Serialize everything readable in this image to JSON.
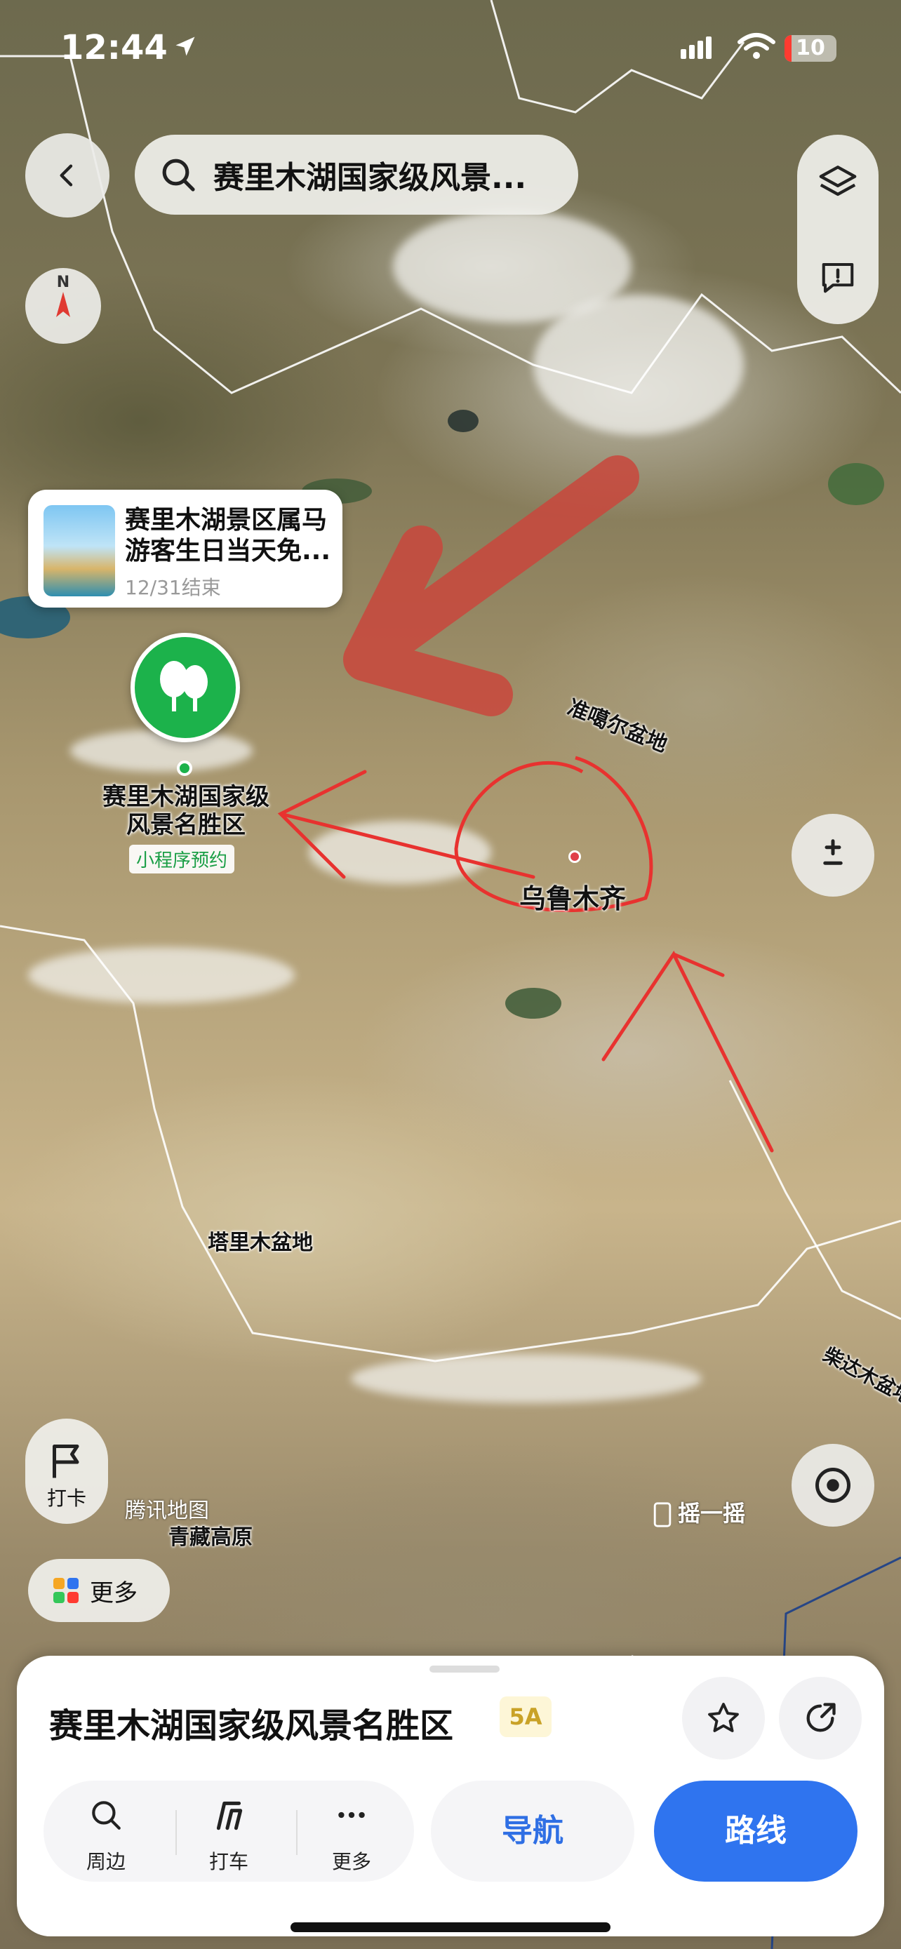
{
  "status_bar": {
    "time": "12:44",
    "battery": "10"
  },
  "search": {
    "text": "赛里木湖国家级风景..."
  },
  "compass": {
    "north": "N"
  },
  "promo": {
    "title": "赛里木湖景区属马游客生日当天免...",
    "date": "12/31结束"
  },
  "pin": {
    "name": "赛里木湖国家级风景名胜区",
    "tag": "小程序预约"
  },
  "map_labels": {
    "junggar": "准噶尔盆地",
    "urumqi": "乌鲁木齐",
    "tarim": "塔里木盆地",
    "qaidam": "柴达木盆地",
    "tibet": "青藏高原"
  },
  "watermark": "腾讯地图",
  "shake": "摇一摇",
  "checkin": {
    "label": "打卡"
  },
  "more_pill": {
    "label": "更多"
  },
  "sheet": {
    "poi_name": "赛里木湖国家级风景名胜区",
    "badge": "5A",
    "actions": [
      {
        "label": "周边",
        "icon": "search-icon"
      },
      {
        "label": "打车",
        "icon": "taxi-icon"
      },
      {
        "label": "更多",
        "icon": "more-dots-icon"
      }
    ],
    "nav_label": "导航",
    "route_label": "路线"
  },
  "colors": {
    "accent_blue": "#2f74ef",
    "pin_green": "#1cb24b",
    "annotation_red": "#e8322f"
  }
}
